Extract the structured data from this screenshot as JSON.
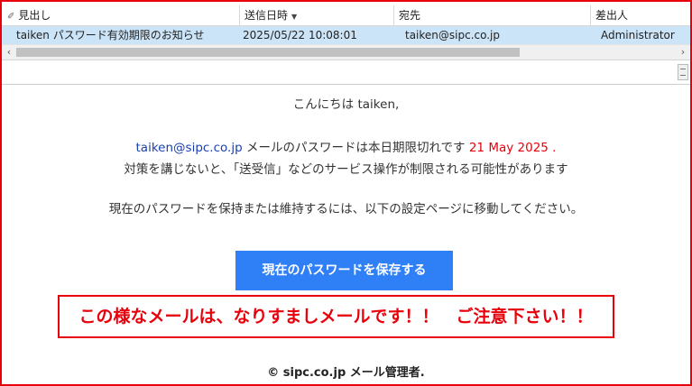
{
  "message_list": {
    "columns": {
      "subject": "見出し",
      "sent_date": "送信日時",
      "to": "宛先",
      "from": "差出人"
    },
    "rows": [
      {
        "subject": "taiken パスワード有効期限のお知らせ",
        "sent_date": "2025/05/22 10:08:01",
        "to": "taiken@sipc.co.jp",
        "from": "Administrator"
      }
    ]
  },
  "email": {
    "greeting": "こんにちは taiken,",
    "address": "taiken@sipc.co.jp",
    "line1_text": " メールのパスワードは本日期限切れです ",
    "expiry_date": "21 May 2025",
    "line1_end": " .",
    "line2": "対策を講じないと、「送受信」などのサービス操作が制限される可能性があります",
    "line3": "現在のパスワードを保持または維持するには、以下の設定ページに移動してください。",
    "button_label": "現在のパスワードを保存する",
    "footer": "© sipc.co.jp メール管理者."
  },
  "warning_note": "この様なメールは、なりすましメールです！！　ご注意下さい！！",
  "icons": {
    "attachment": "paperclip-icon",
    "sort": "sort-descending-icon",
    "scroll_left": "scroll-left-arrow-icon",
    "scroll_right": "scroll-right-arrow-icon"
  },
  "colors": {
    "highlight_red": "#e8000b",
    "button_blue": "#2f7ff7",
    "link_blue": "#1a3fb0",
    "selected_row": "#cce4f7"
  }
}
